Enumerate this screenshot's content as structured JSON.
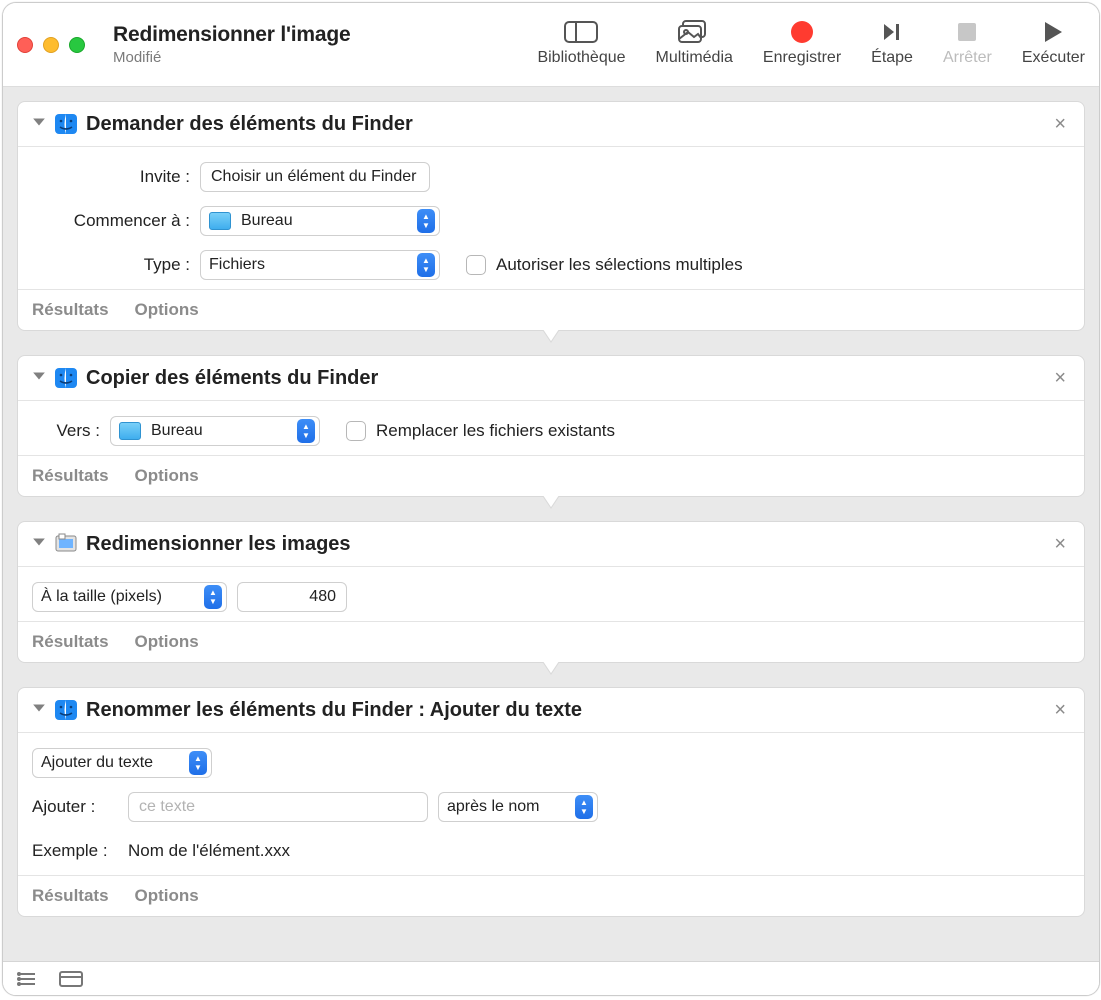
{
  "window": {
    "title": "Redimensionner l'image",
    "subtitle": "Modifié"
  },
  "toolbar": {
    "library": "Bibliothèque",
    "media": "Multimédia",
    "record": "Enregistrer",
    "step": "Étape",
    "stop": "Arrêter",
    "run": "Exécuter"
  },
  "footer_labels": {
    "results": "Résultats",
    "options": "Options"
  },
  "actions": [
    {
      "title": "Demander des éléments du Finder",
      "icon": "finder-icon",
      "rows": {
        "invite_label": "Invite :",
        "invite_value": "Choisir un élément du Finder :",
        "start_label": "Commencer à :",
        "start_value": "Bureau",
        "type_label": "Type :",
        "type_value": "Fichiers",
        "allow_multiple_label": "Autoriser les sélections multiples"
      }
    },
    {
      "title": "Copier des éléments du Finder",
      "icon": "finder-icon",
      "rows": {
        "to_label": "Vers :",
        "to_value": "Bureau",
        "replace_label": "Remplacer les fichiers existants"
      }
    },
    {
      "title": "Redimensionner les images",
      "icon": "preview-icon",
      "rows": {
        "mode_value": "À la taille (pixels)",
        "size_value": "480"
      }
    },
    {
      "title": "Renommer les éléments du Finder : Ajouter du texte",
      "icon": "finder-icon",
      "rows": {
        "mode_value": "Ajouter du texte",
        "add_label": "Ajouter :",
        "add_placeholder": "ce texte",
        "position_value": "après le nom",
        "example_label": "Exemple :",
        "example_value": "Nom de l'élément.xxx"
      }
    }
  ]
}
